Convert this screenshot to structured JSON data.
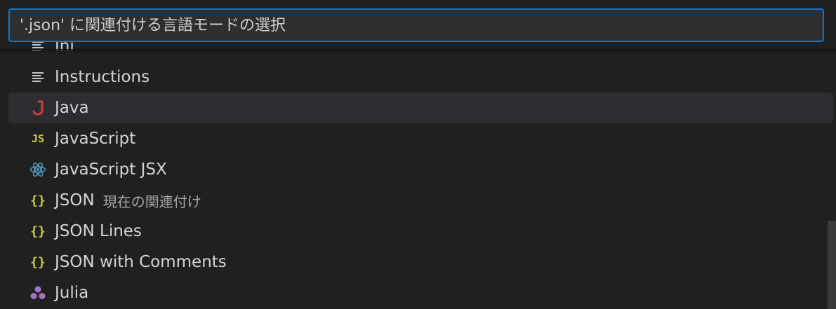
{
  "search": {
    "placeholder": "'.json' に関連付ける言語モードの選択"
  },
  "items": [
    {
      "label": "Ini",
      "icon": "lines-icon",
      "focused": false
    },
    {
      "label": "Instructions",
      "icon": "lines-icon",
      "focused": false
    },
    {
      "label": "Java",
      "icon": "java-icon",
      "focused": true
    },
    {
      "label": "JavaScript",
      "icon": "js-icon",
      "icon_text": "JS",
      "focused": false
    },
    {
      "label": "JavaScript JSX",
      "icon": "react-icon",
      "focused": false
    },
    {
      "label": "JSON",
      "description": "現在の関連付け",
      "icon": "braces-icon",
      "icon_text": "{}",
      "focused": false
    },
    {
      "label": "JSON Lines",
      "icon": "braces-icon",
      "icon_text": "{}",
      "focused": false
    },
    {
      "label": "JSON with Comments",
      "icon": "braces-icon",
      "icon_text": "{}",
      "focused": false
    },
    {
      "label": "Julia",
      "icon": "julia-icon",
      "focused": false
    }
  ],
  "colors": {
    "accent": "#0a78d2",
    "java": "#cc3e44",
    "js": "#cbcb41",
    "react": "#519aba",
    "braces": "#cbcb41",
    "julia": "#a074c4"
  }
}
